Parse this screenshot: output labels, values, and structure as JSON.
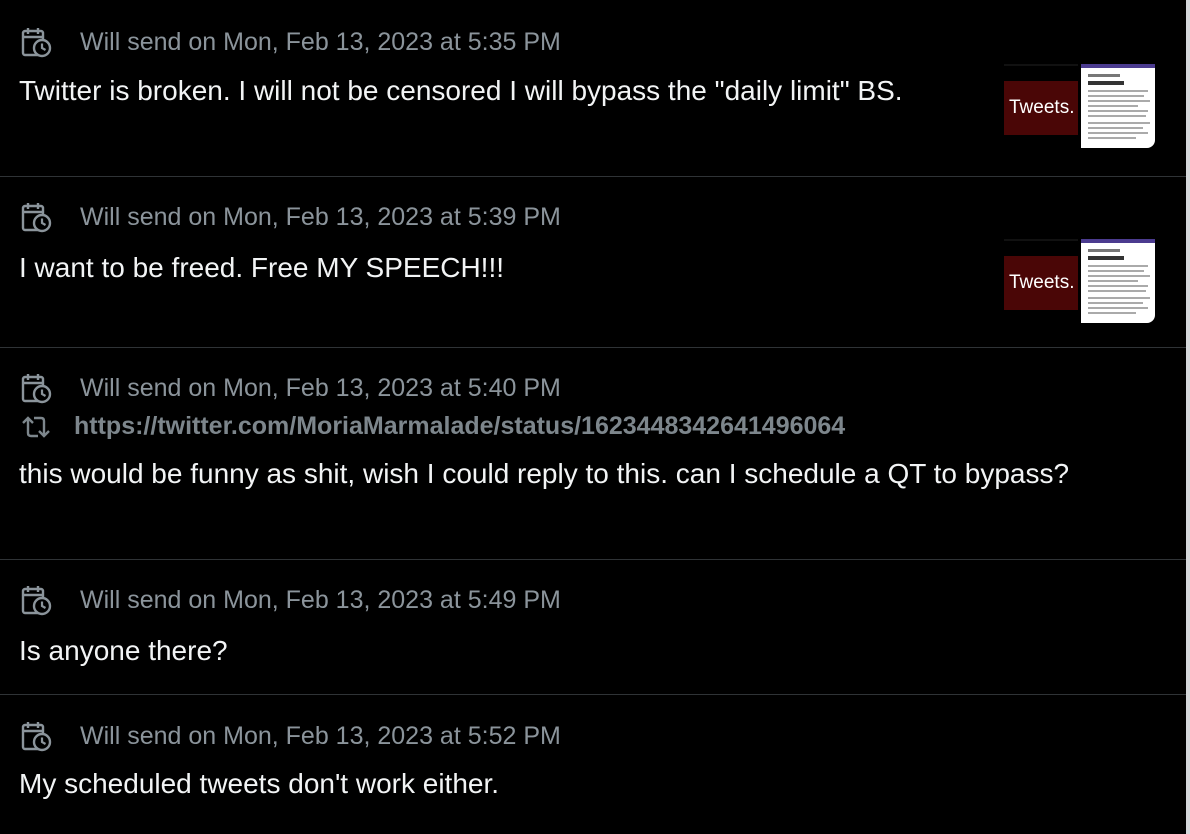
{
  "scheduled": [
    {
      "schedule_text": "Will send on Mon, Feb 13, 2023 at 5:35 PM",
      "body": "Twitter is broken. I will not be censored I will bypass the \"daily limit\" BS.",
      "media_thumb_text": "Tweets."
    },
    {
      "schedule_text": "Will send on Mon, Feb 13, 2023 at 5:39 PM",
      "body": "I want to be freed. Free MY SPEECH!!!",
      "media_thumb_text": "Tweets."
    },
    {
      "schedule_text": "Will send on Mon, Feb 13, 2023 at 5:40 PM",
      "quote_url": "https://twitter.com/MoriaMarmalade/status/1623448342641496064",
      "body": "this would be funny as shit, wish I could reply to this. can I schedule a QT to bypass?"
    },
    {
      "schedule_text": "Will send on Mon, Feb 13, 2023 at 5:49 PM",
      "body": "Is anyone there?"
    },
    {
      "schedule_text": "Will send on Mon, Feb 13, 2023 at 5:52 PM",
      "body": "My scheduled tweets don't work either."
    }
  ],
  "icons": {
    "schedule": "calendar-clock-icon",
    "quote": "retweet-icon"
  },
  "colors": {
    "background": "#000000",
    "muted": "#8b949b",
    "text": "#f2f4f5",
    "divider": "#2f3336"
  }
}
